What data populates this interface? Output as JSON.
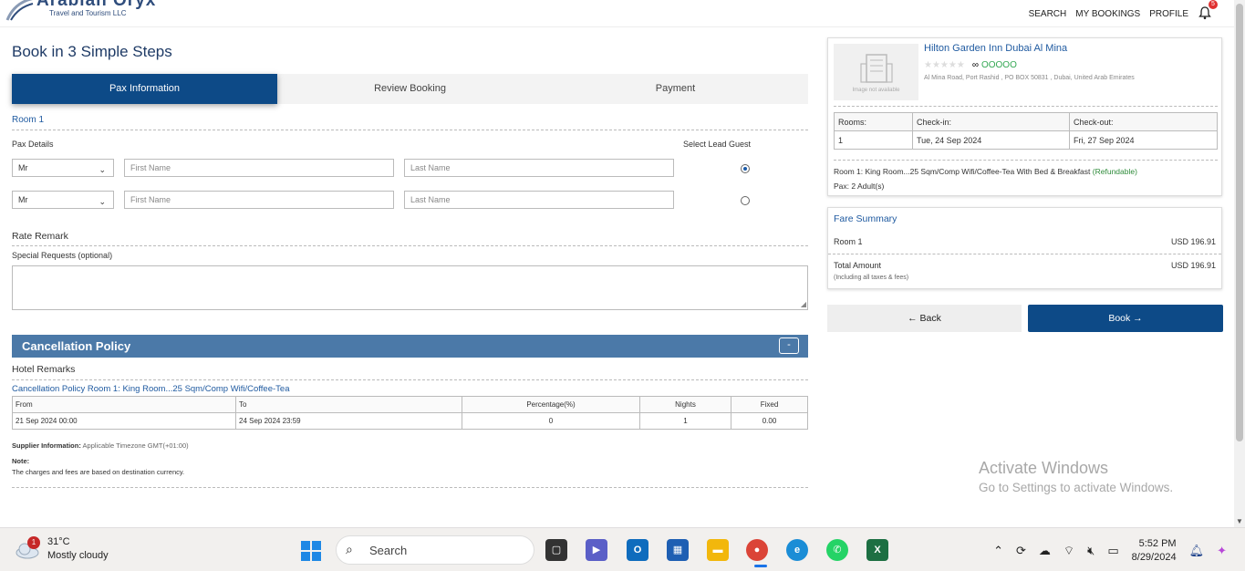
{
  "header": {
    "logo_name": "Arabian Oryx",
    "logo_sub": "Travel and Tourism LLC",
    "nav": [
      "SEARCH",
      "MY BOOKINGS",
      "PROFILE"
    ],
    "notif_count": "5"
  },
  "page_title": "Book in 3 Simple Steps",
  "steps": [
    "Pax Information",
    "Review Booking",
    "Payment"
  ],
  "room": {
    "label": "Room 1",
    "pax_details_label": "Pax Details",
    "lead_guest_label": "Select Lead Guest",
    "guests": [
      {
        "title": "Mr",
        "first_placeholder": "First Name",
        "last_placeholder": "Last Name",
        "lead": true
      },
      {
        "title": "Mr",
        "first_placeholder": "First Name",
        "last_placeholder": "Last Name",
        "lead": false
      }
    ]
  },
  "rate_remark_label": "Rate Remark",
  "special_requests_label": "Special Requests (optional)",
  "cancellation": {
    "title": "Cancellation Policy",
    "toggle": "-",
    "hotel_remarks": "Hotel Remarks",
    "policy_title": "Cancellation Policy Room 1: King Room...25 Sqm/Comp Wifi/Coffee-Tea",
    "columns": [
      "From",
      "To",
      "Percentage(%)",
      "Nights",
      "Fixed"
    ],
    "rows": [
      [
        "21 Sep 2024  00:00",
        "24 Sep 2024  23:59",
        "0",
        "1",
        "0.00"
      ]
    ],
    "supplier_label": "Supplier Information:",
    "supplier_value": "Applicable Timezone GMT(+01:00)",
    "note_label": "Note:",
    "note_value": "The charges and fees are based on destination currency."
  },
  "hotel": {
    "name": "Hilton Garden Inn Dubai Al Mina",
    "image_text": "Image not available",
    "stars": "★★★★★",
    "ta_rating": "OOOOO",
    "address": "Al Mina Road, Port Rashid , PO BOX 50831 , Dubai, United Arab Emirates",
    "table_headers": [
      "Rooms:",
      "Check-in:",
      "Check-out:"
    ],
    "table_values": [
      "1",
      "Tue, 24 Sep 2024",
      "Fri, 27 Sep 2024"
    ],
    "room_text": "Room 1: King Room...25 Sqm/Comp Wifi/Coffee-Tea With Bed & Breakfast",
    "refundable": "(Refundable)",
    "pax": "Pax: 2 Adult(s)"
  },
  "fare": {
    "title": "Fare Summary",
    "room_label": "Room 1",
    "room_value": "USD 196.91",
    "total_label": "Total Amount",
    "total_value": "USD 196.91",
    "total_note": "(Including all taxes & fees)"
  },
  "buttons": {
    "back": "← Back",
    "book": "Book →"
  },
  "activate": {
    "line1": "Activate Windows",
    "line2": "Go to Settings to activate Windows."
  },
  "taskbar": {
    "weather_badge": "1",
    "temp": "31°C",
    "condition": "Mostly cloudy",
    "search": "Search",
    "time": "5:52 PM",
    "date": "8/29/2024"
  }
}
